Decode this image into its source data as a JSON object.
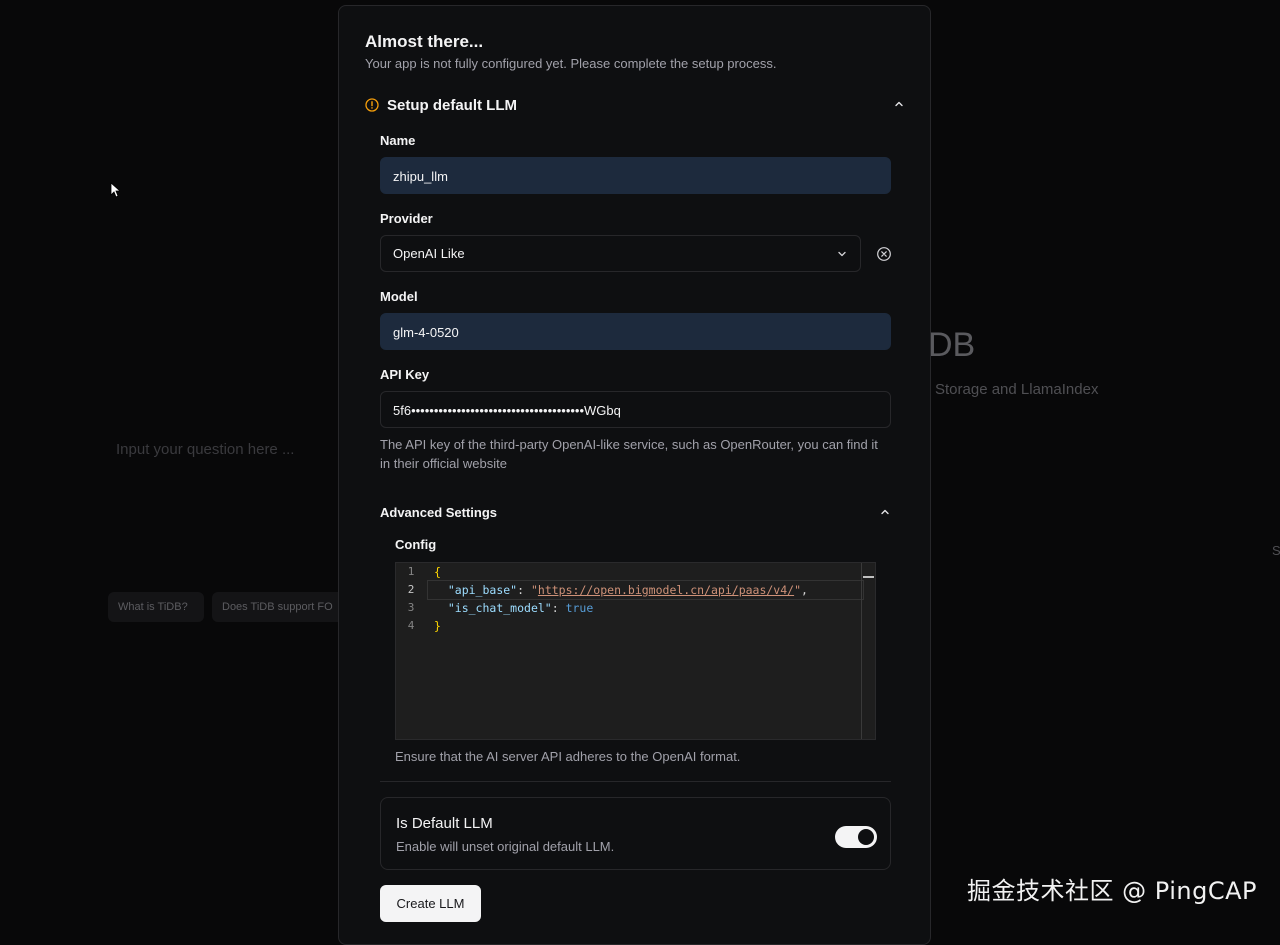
{
  "background": {
    "title_fragment": "DB",
    "subtitle_fragment": "Storage and LlamaIndex",
    "input_placeholder": "Input your question here ...",
    "right_fragment": "S",
    "suggestions": [
      "What is TiDB?",
      "Does TiDB support FO"
    ]
  },
  "dialog": {
    "title": "Almost there...",
    "description": "Your app is not fully configured yet. Please complete the setup process.",
    "section_title": "Setup default LLM",
    "fields": {
      "name_label": "Name",
      "name_value": "zhipu_llm",
      "provider_label": "Provider",
      "provider_value": "OpenAI Like",
      "model_label": "Model",
      "model_value": "glm-4-0520",
      "api_key_label": "API Key",
      "api_key_value": "5f6••••••••••••••••••••••••••••••••••••••WGbq",
      "api_key_help": "The API key of the third-party OpenAI-like service, such as OpenRouter, you can find it in their official website"
    },
    "advanced": {
      "title": "Advanced Settings",
      "config_label": "Config",
      "line_numbers": [
        "1",
        "2",
        "3",
        "4"
      ],
      "code": {
        "open_brace": "{",
        "key1": "\"api_base\"",
        "colon": ": ",
        "value1_quote_open": "\"",
        "value1_url": "https://open.bigmodel.cn/api/paas/v4/",
        "value1_quote_close": "\"",
        "comma": ",",
        "key2": "\"is_chat_model\"",
        "value2": "true",
        "close_brace": "}"
      },
      "help": "Ensure that the AI server API adheres to the OpenAI format."
    },
    "default_llm": {
      "title": "Is Default LLM",
      "description": "Enable will unset original default LLM.",
      "enabled": true
    },
    "submit_label": "Create LLM"
  },
  "watermark": "掘金技术社区 @ PingCAP",
  "colors": {
    "filled_input": "#1d2a3d",
    "warning": "#f59e0b",
    "dialog_bg": "#0e0f11"
  }
}
